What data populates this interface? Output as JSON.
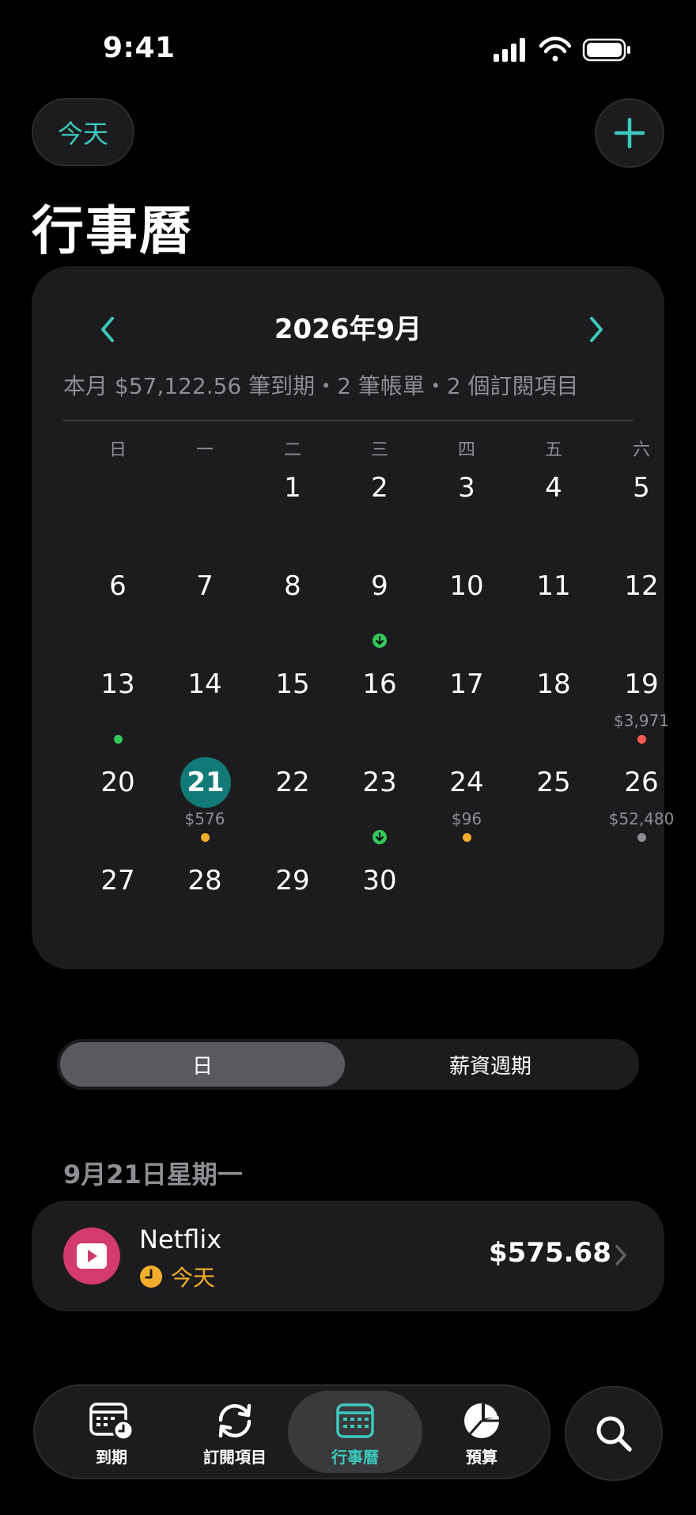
{
  "status": {
    "time": "9:41"
  },
  "header": {
    "today_label": "今天",
    "title": "行事曆"
  },
  "calendar": {
    "month_label": "2026年9月",
    "summary": "本月 $57,122.56 筆到期・2 筆帳單・2 個訂閱項目",
    "weekdays": [
      "日",
      "一",
      "二",
      "三",
      "四",
      "五",
      "六"
    ],
    "weeks": [
      [
        null,
        null,
        {
          "d": "1"
        },
        {
          "d": "2"
        },
        {
          "d": "3"
        },
        {
          "d": "4"
        },
        {
          "d": "5"
        }
      ],
      [
        {
          "d": "6"
        },
        {
          "d": "7"
        },
        {
          "d": "8"
        },
        {
          "d": "9",
          "pay": true
        },
        {
          "d": "10"
        },
        {
          "d": "11"
        },
        {
          "d": "12"
        }
      ],
      [
        {
          "d": "13",
          "dot": "#34c759"
        },
        {
          "d": "14"
        },
        {
          "d": "15"
        },
        {
          "d": "16"
        },
        {
          "d": "17"
        },
        {
          "d": "18"
        },
        {
          "d": "19",
          "amt": "$3,971",
          "dot": "#ff5b52"
        }
      ],
      [
        {
          "d": "20"
        },
        {
          "d": "21",
          "amt": "$576",
          "dot": "#f4ae2b",
          "selected": true
        },
        {
          "d": "22"
        },
        {
          "d": "23",
          "pay": true
        },
        {
          "d": "24",
          "amt": "$96",
          "dot": "#f4ae2b"
        },
        {
          "d": "25"
        },
        {
          "d": "26",
          "amt": "$52,480",
          "dot": "#8e8e93"
        }
      ],
      [
        {
          "d": "27"
        },
        {
          "d": "28"
        },
        {
          "d": "29"
        },
        {
          "d": "30"
        },
        null,
        null,
        null
      ]
    ]
  },
  "segment": {
    "day_label": "日",
    "pay_label": "薪資週期"
  },
  "section": {
    "date_label": "9月21日星期一"
  },
  "item": {
    "name": "Netflix",
    "due": "今天",
    "amount": "$575.68",
    "icon": "play-icon"
  },
  "tabs": [
    {
      "label": "到期",
      "icon": "calendar-clock-icon"
    },
    {
      "label": "訂閱項目",
      "icon": "refresh-icon"
    },
    {
      "label": "行事曆",
      "icon": "calendar-icon",
      "active": true
    },
    {
      "label": "預算",
      "icon": "pie-chart-icon"
    }
  ],
  "colors": {
    "accent": "#3cc9bd",
    "selected_day": "#127a76",
    "netflix": "#d33a6d",
    "due_today": "#f4ae2b"
  }
}
